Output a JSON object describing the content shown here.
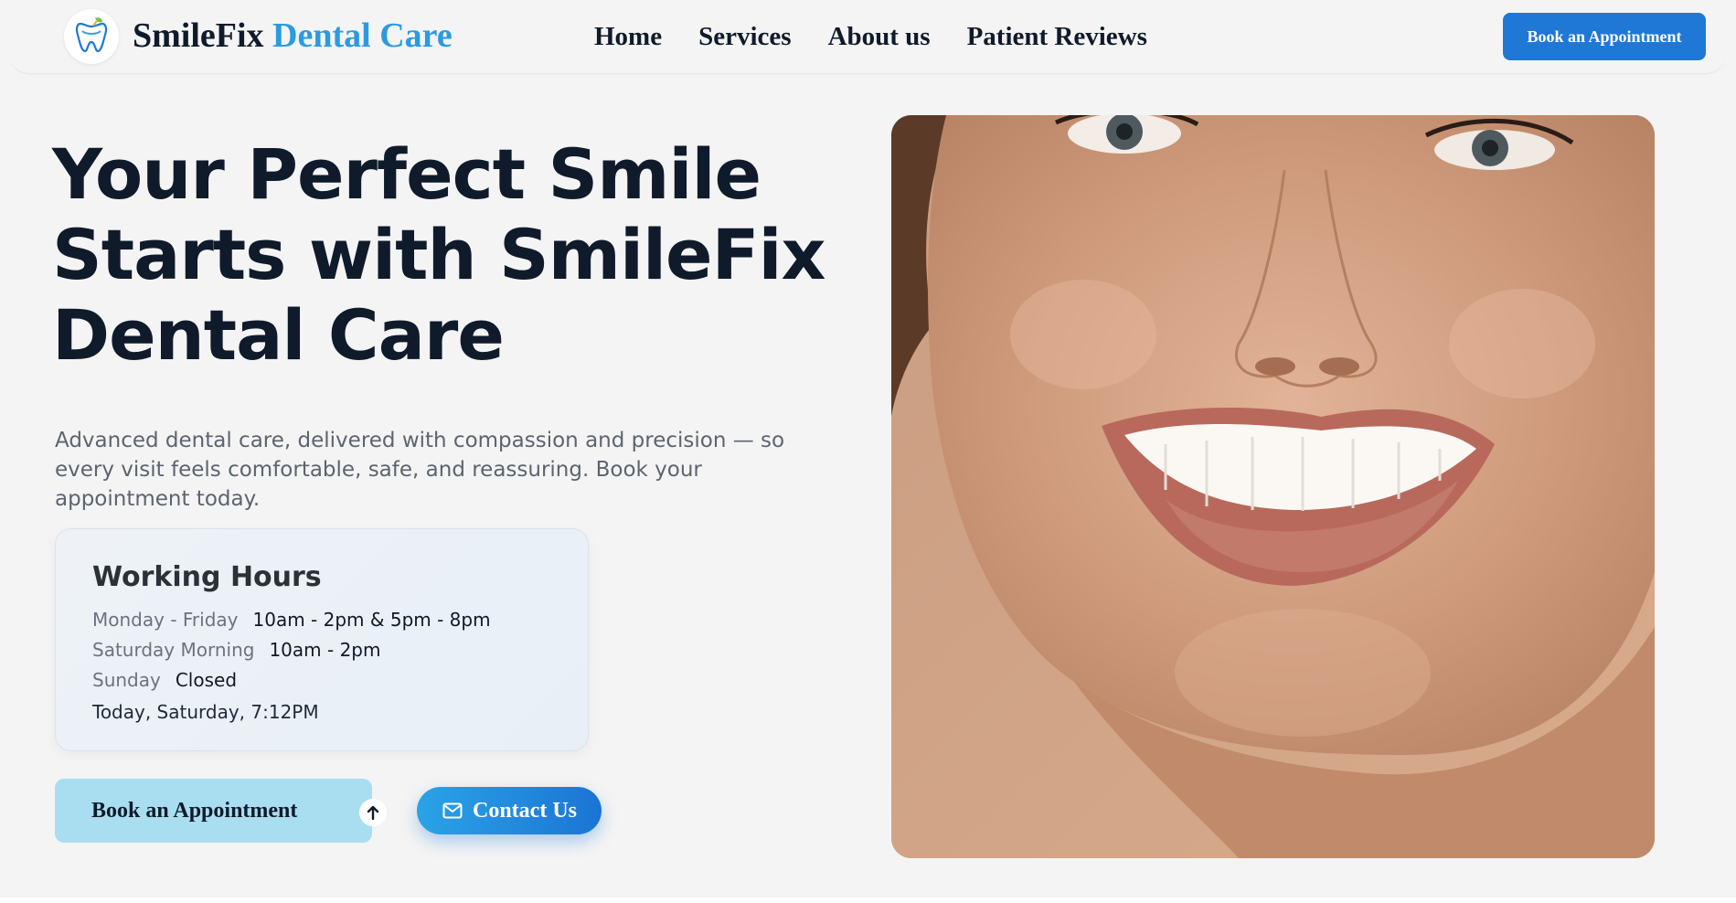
{
  "header": {
    "brand_part1": "SmileFix",
    "brand_part2": "Dental Care",
    "nav": [
      "Home",
      "Services",
      "About us",
      "Patient Reviews"
    ],
    "cta_label": "Book an Appointment"
  },
  "hero": {
    "title": "Your Perfect Smile Starts with SmileFix Dental Care",
    "description": "Advanced dental care, delivered with compassion and precision — so every visit feels comfortable, safe, and reassuring. Book your appointment today.",
    "hours": {
      "title": "Working Hours",
      "rows": [
        {
          "label": "Monday - Friday",
          "value": "10am - 2pm & 5pm - 8pm"
        },
        {
          "label": "Saturday Morning",
          "value": "10am - 2pm"
        },
        {
          "label": "Sunday",
          "value": "Closed"
        }
      ],
      "today": "Today, Saturday, 7:12PM"
    },
    "book_label": "Book an Appointment",
    "contact_label": "Contact Us"
  },
  "colors": {
    "brand_dark": "#0f1b2b",
    "brand_accent": "#2b9be0",
    "cta_blue": "#1f78d6",
    "book_button_bg": "#a9def0",
    "page_bg": "#f4f4f4"
  },
  "icons": {
    "logo": "tooth-logo-icon",
    "book_arrow": "arrow-up-icon",
    "contact": "mail-icon"
  }
}
